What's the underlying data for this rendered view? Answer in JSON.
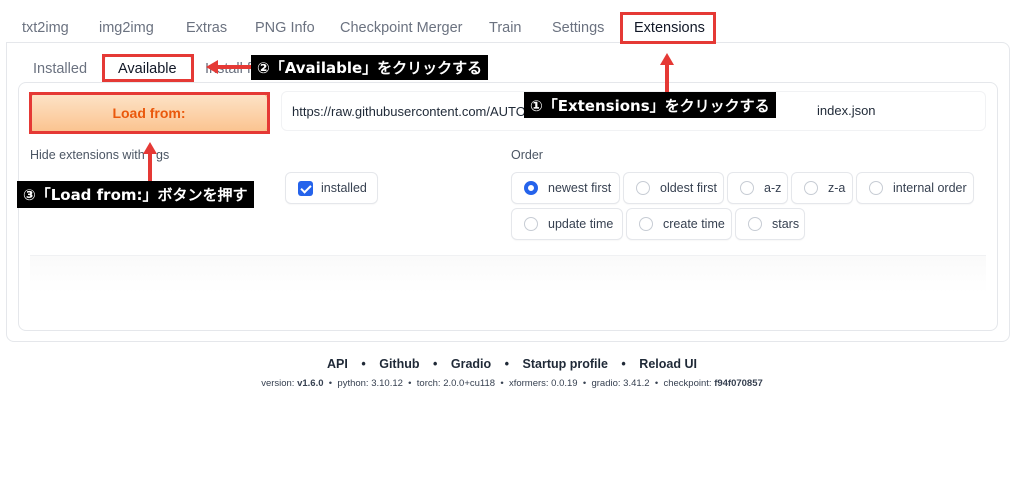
{
  "top_tabs": [
    {
      "label": "txt2img"
    },
    {
      "label": "img2img"
    },
    {
      "label": "Extras"
    },
    {
      "label": "PNG Info"
    },
    {
      "label": "Checkpoint Merger"
    },
    {
      "label": "Train"
    },
    {
      "label": "Settings"
    },
    {
      "label": "Extensions",
      "selected": true
    }
  ],
  "sub_tabs": [
    {
      "label": "Installed"
    },
    {
      "label": "Available",
      "selected": true
    },
    {
      "label": "Install f"
    }
  ],
  "load_button": {
    "label": "Load from:"
  },
  "url_field": {
    "value_start": "https://raw.githubusercontent.com/AUTOM",
    "value_end": "index.json"
  },
  "hide_extensions": {
    "label_start": "Hide extensions with",
    "label_end": "gs",
    "installed_label": "installed",
    "installed_checked": true
  },
  "order": {
    "label": "Order",
    "options": [
      {
        "label": "newest first",
        "selected": true
      },
      {
        "label": "oldest first"
      },
      {
        "label": "a-z"
      },
      {
        "label": "z-a"
      },
      {
        "label": "internal order"
      },
      {
        "label": "update time"
      },
      {
        "label": "create time"
      },
      {
        "label": "stars"
      }
    ]
  },
  "annotations": {
    "step1": "①「Extensions」をクリックする",
    "step2": "②「Available」をクリックする",
    "step3": "③「Load from:」ボタンを押す",
    "color": "#e53935"
  },
  "footer": {
    "links": [
      "API",
      "Github",
      "Gradio",
      "Startup profile",
      "Reload UI"
    ],
    "separator": "•",
    "info": {
      "version_label": "version:",
      "version": "v1.6.0",
      "python": "python: 3.10.12",
      "torch": "torch: 2.0.0+cu118",
      "xformers": "xformers: 0.0.19",
      "gradio": "gradio: 3.41.2",
      "checkpoint_label": "checkpoint:",
      "checkpoint": "f94f070857"
    }
  },
  "colors": {
    "accent": "#2563eb",
    "load_button_text": "#ea580c"
  }
}
